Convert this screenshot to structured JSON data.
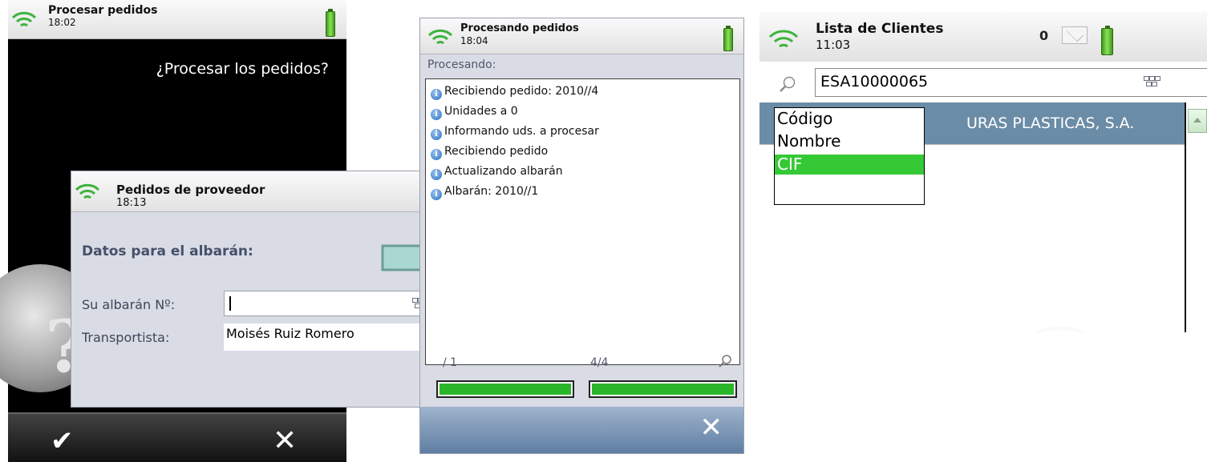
{
  "panel1": {
    "title": "Procesar pedidos",
    "time": "18:02",
    "question": "¿Procesar los pedidos?",
    "ok_symbol": "✔",
    "cancel_symbol": "✕",
    "icons": [
      "wifi-icon",
      "battery-icon",
      "question-icon",
      "check-icon",
      "close-icon"
    ]
  },
  "dialog": {
    "title": "Pedidos de proveedor",
    "time": "18:13",
    "section": "Datos para el albarán:",
    "albaran_label": "Su albarán Nº:",
    "albaran_value": "",
    "transportista_label": "Transportista:",
    "transportista_value": "Moisés Ruiz Romero"
  },
  "panel2": {
    "title": "Procesando pedidos",
    "time": "18:04",
    "status": "Procesando:",
    "log": [
      "Recibiendo pedido: 2010//4",
      "Unidades a 0",
      "Informando uds. a procesar",
      "Recibiendo pedido",
      "Actualizando albarán",
      "Albarán: 2010//1"
    ],
    "counter_left": "/ 1",
    "counter_right": "4/4",
    "progress_left": 1.0,
    "progress_right": 1.0,
    "cancel_symbol": "✕"
  },
  "panel3": {
    "title": "Lista de Clientes",
    "time": "11:03",
    "message_count": "0",
    "search_value": "ESA10000065",
    "selected_row_text": "URAS PLASTICAS, S.A.",
    "dropdown_options": [
      "Código",
      "Nombre",
      "CIF"
    ],
    "dropdown_selected": "CIF"
  },
  "colors": {
    "accent_green": "#35c935",
    "row_highlight": "#6b8ca6",
    "panel_bg": "#d9dce5",
    "arrow_fill": "#a9d8d3"
  }
}
